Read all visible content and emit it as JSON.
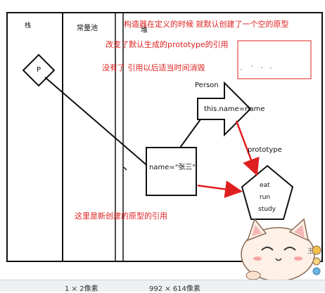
{
  "labels": {
    "stack": "栈",
    "constant_pool": "常量池",
    "heap": "堆",
    "p": "P",
    "person": "Person",
    "constructor_body": "this.name=name",
    "instance": "name=\"张三\"",
    "prototype": "prototype",
    "proto_methods": [
      "eat",
      "run",
      "study"
    ]
  },
  "notes": {
    "note1": "构造器在定义的时候 就默认创建了一个空的原型",
    "note2": "改变了默认生成的prototype的引用",
    "note3": "没有了 引用以后适当时间消毁",
    "note4": "这里是新创建的原型的引用"
  },
  "status": {
    "left": "1 × 2像素",
    "right": "992 × 614像素"
  },
  "mascot_text": "王",
  "colors": {
    "accent": "#e02020",
    "line": "#111111",
    "status_bg": "#eef0f3"
  }
}
